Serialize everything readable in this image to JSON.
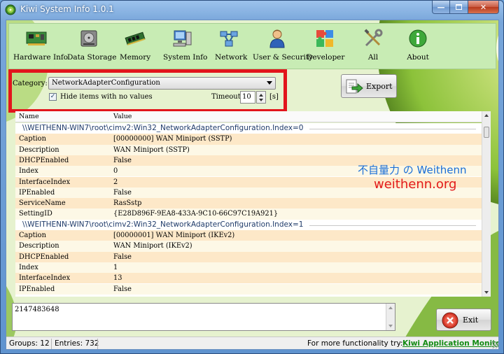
{
  "window": {
    "title": "Kiwi System Info 1.0.1"
  },
  "toolbar": {
    "items": [
      {
        "label": "Hardware Info",
        "icon": "circuit-board-icon"
      },
      {
        "label": "Data Storage",
        "icon": "hard-drive-icon"
      },
      {
        "label": "Memory",
        "icon": "memory-module-icon"
      },
      {
        "label": "System Info",
        "icon": "computer-icon"
      },
      {
        "label": "Network",
        "icon": "network-icon"
      },
      {
        "label": "User & Security",
        "icon": "user-icon"
      },
      {
        "label": "Developer",
        "icon": "puzzle-icon"
      },
      {
        "label": "All",
        "icon": "tools-icon"
      },
      {
        "label": "About",
        "icon": "info-icon"
      }
    ]
  },
  "filters": {
    "category_label": "Category:",
    "category_value": "NetworkAdapterConfiguration",
    "hide_empty_label": "Hide items with no values",
    "hide_empty_checked": true,
    "timeout_label": "Timeout:",
    "timeout_value": "10",
    "timeout_unit": "[s]"
  },
  "export_button": {
    "label": "Export"
  },
  "grid": {
    "columns": [
      "Name",
      "Value"
    ],
    "rows": [
      {
        "type": "group",
        "name": "\\\\WEITHENN-WIN7\\root\\cimv2:Win32_NetworkAdapterConfiguration.Index=0"
      },
      {
        "name": "Caption",
        "value": "[00000000] WAN Miniport (SSTP)"
      },
      {
        "name": "Description",
        "value": "WAN Miniport (SSTP)"
      },
      {
        "name": "DHCPEnabled",
        "value": "False"
      },
      {
        "name": "Index",
        "value": "0"
      },
      {
        "name": "InterfaceIndex",
        "value": "2"
      },
      {
        "name": "IPEnabled",
        "value": "False"
      },
      {
        "name": "ServiceName",
        "value": "RasSstp"
      },
      {
        "name": "SettingID",
        "value": "{E28D896F-9EA8-433A-9C10-66C97C19A921}"
      },
      {
        "type": "group",
        "name": "\\\\WEITHENN-WIN7\\root\\cimv2:Win32_NetworkAdapterConfiguration.Index=1"
      },
      {
        "name": "Caption",
        "value": "[00000001] WAN Miniport (IKEv2)"
      },
      {
        "name": "Description",
        "value": "WAN Miniport (IKEv2)"
      },
      {
        "name": "DHCPEnabled",
        "value": "False"
      },
      {
        "name": "Index",
        "value": "1"
      },
      {
        "name": "InterfaceIndex",
        "value": "13"
      },
      {
        "name": "IPEnabled",
        "value": "False"
      }
    ]
  },
  "watermark": {
    "line1": "不自量力 の Weithenn",
    "line2": "weithenn.org"
  },
  "detail": {
    "value": "2147483648"
  },
  "exit_button": {
    "label": "Exit"
  },
  "status": {
    "groups": "Groups: 12",
    "entries": "Entries: 732",
    "promo_text": "For more functionality try:",
    "promo_link": "Kiwi Application Monitor"
  },
  "colors": {
    "highlight_border": "#e2151c",
    "row_odd": "#fde8c8",
    "row_even": "#fdf8e6",
    "promo_link": "#128a12",
    "watermark_blue": "#1a6ed6",
    "watermark_red": "#e21a1a"
  }
}
